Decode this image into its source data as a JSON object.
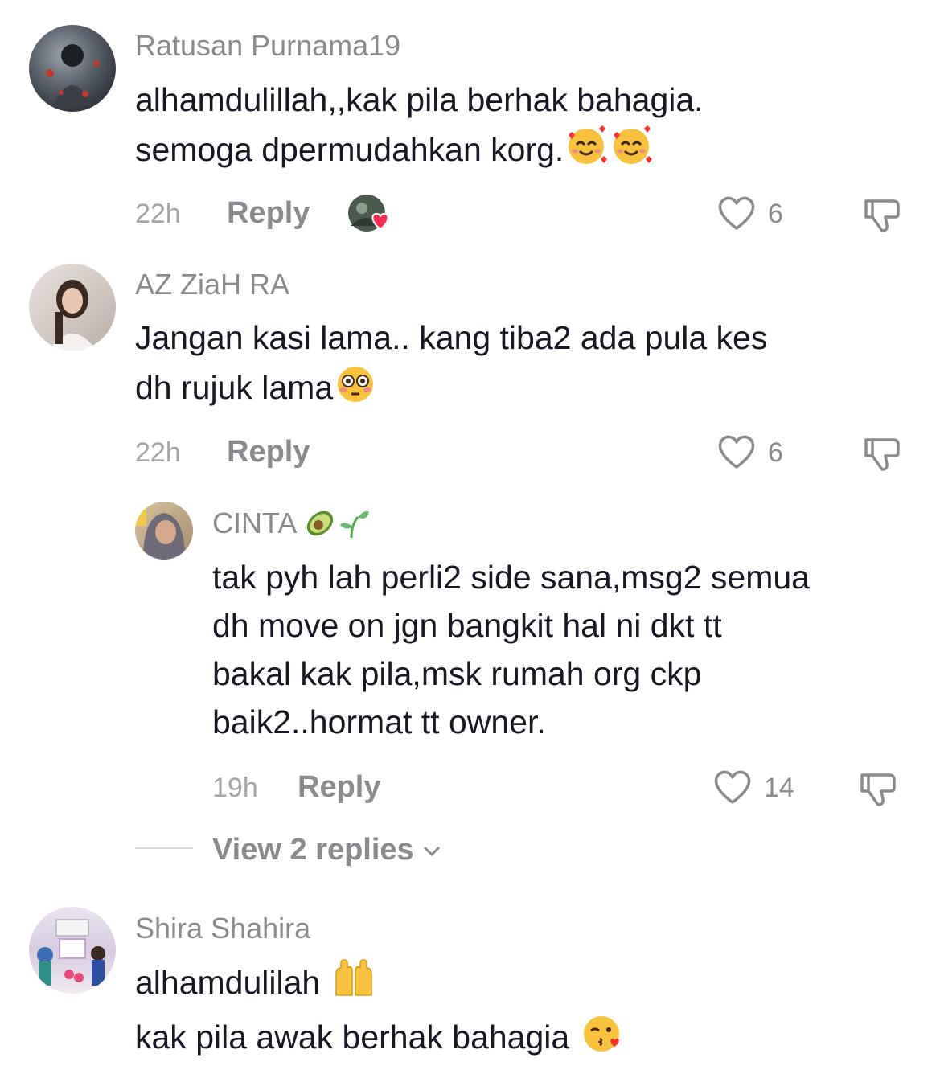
{
  "comments": [
    {
      "username": "Ratusan Purnama19",
      "line1": "alhamdulillah,,kak pila berhak bahagia.",
      "line2": "semoga dpermudahkan korg.",
      "time": "22h",
      "reply_label": "Reply",
      "likes": "6"
    },
    {
      "username": "AZ ZiaH RA",
      "line1": "Jangan kasi lama.. kang tiba2 ada pula kes",
      "line2": "dh rujuk lama",
      "time": "22h",
      "reply_label": "Reply",
      "likes": "6",
      "replies": [
        {
          "username": "CINTA",
          "line1": "tak pyh lah perli2 side sana,msg2 semua",
          "line2": "dh move on jgn bangkit hal ni dkt tt",
          "line3": "bakal kak pila,msk rumah org ckp",
          "line4": "baik2..hormat tt owner.",
          "time": "19h",
          "reply_label": "Reply",
          "likes": "14"
        }
      ],
      "view_replies_label": "View 2 replies"
    },
    {
      "username": "Shira Shahira",
      "line1": "alhamdulilah",
      "line2": "kak pila awak berhak bahagia"
    }
  ],
  "colors": {
    "text": "#161823",
    "muted": "#8a8a8f",
    "heart": "#fe2c55",
    "emoji": "#f9c23c"
  },
  "icons": [
    "heart-outline-icon",
    "dislike-icon",
    "chevron-down-icon",
    "creator-liked-icon"
  ]
}
